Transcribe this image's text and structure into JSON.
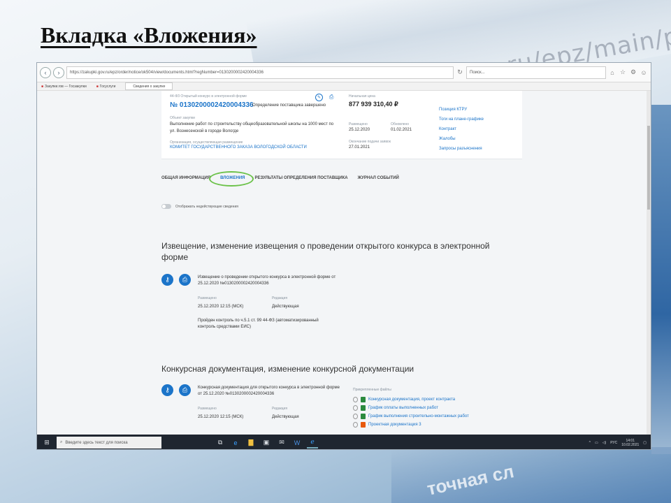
{
  "slide": {
    "title": "Вкладка «Вложения»",
    "bg_url": "zakupki.gov.ru/epz/main/public/home.htm",
    "bg_bottom_text": "точная сл"
  },
  "browser": {
    "url": "https://zakupki.gov.ru/epz/order/notice/ok504/view/documents.html?regNumber=0130200002420004336",
    "search_placeholder": "Поиск...",
    "favorites": [
      "Закупки.гов — Госзакупки",
      "Госуслуги"
    ],
    "active_tab": "Сведения о закупке"
  },
  "card": {
    "type_label": "44-ФЗ Открытый конкурс в электронной форме",
    "status_label": "Определение поставщика завершено",
    "purchase_number": "№ 0130200002420004336",
    "object_label": "Объект закупки",
    "object_text": "Выполнение работ по строительству общеобразовательной школы на 1000 мест по ул. Вознесенской в городе Вологде",
    "customer_label": "Организация, осуществляющая размещение",
    "customer_text": "КОМИТЕТ ГОСУДАРСТВЕННОГО ЗАКАЗА ВОЛОГОДСКОЙ ОБЛАСТИ",
    "price_label": "Начальная цена",
    "price": "877 939 310,40 ₽",
    "placed_label": "Размещено",
    "placed": "25.12.2020",
    "updated_label": "Обновлено",
    "updated": "01.02.2021",
    "end_label": "Окончание подачи заявок",
    "end": "27.01.2021",
    "side_links": [
      "Позиция КТРУ",
      "Тоги на плане-графике",
      "Контракт",
      "Жалобы",
      "Запросы разъяснения"
    ]
  },
  "tabs": [
    "ОБЩАЯ ИНФОРМАЦИЯ",
    "ВЛОЖЕНИЯ",
    "РЕЗУЛЬТАТЫ ОПРЕДЕЛЕНИЯ ПОСТАВЩИКА",
    "ЖУРНАЛ СОБЫТИЙ"
  ],
  "toggle_label": "Отображать недействующие сведения",
  "section1": {
    "title": "Извещение, изменение извещения о проведении открытого конкурса в электронной форме",
    "doc_title": "Извещение о проведении открытого конкурса в электронной форме от 25.12.2020 №0130200002420004336",
    "placed_label": "Размещено",
    "placed_value": "25.12.2020 12:15 (МСК)",
    "edition_label": "Редакция",
    "edition_value": "Действующая",
    "control_text": "Пройден контроль по ч.5.1 ст. 99 44-ФЗ (автоматизированный контроль средствами ЕИС)"
  },
  "section2": {
    "title": "Конкурсная документация, изменение конкурсной документации",
    "doc_title": "Конкурсная документация для открытого конкурса в электронной форме от 25.12.2020 №0130200002420004336",
    "placed_label": "Размещено",
    "placed_value": "25.12.2020 12:15 (МСК)",
    "edition_label": "Редакция",
    "edition_value": "Действующая",
    "files_header": "Прикрепленные файлы",
    "files": [
      "Конкурсная документация, проект контракта",
      "График оплаты выполненных работ",
      "График выполнения строительно-монтажных работ",
      "Проектная документация 3"
    ],
    "file_colors": [
      "#2b8a3e",
      "#2b8a3e",
      "#2b8a3e",
      "#e8590c"
    ]
  },
  "taskbar": {
    "search_placeholder": "Введите здесь текст для поиска",
    "lang": "РУС",
    "time": "14:01",
    "date": "10.02.2021"
  },
  "colors": {
    "accent": "#1b74c9",
    "highlight": "#6cc24a"
  }
}
